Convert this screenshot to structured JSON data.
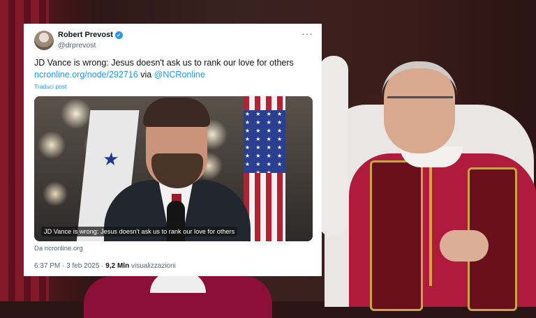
{
  "tweet": {
    "name": "Robert Prevost",
    "handle": "@drprevost",
    "text_line1": "JD Vance is wrong: Jesus doesn't ask us to rank our love for others",
    "link_url": "ncronline.org/node/292716",
    "via_word": "via",
    "mention": "@NCRonline",
    "translate": "Traduci post",
    "media_caption": "JD Vance is wrong: Jesus doesn't ask us to rank our love for others",
    "source": "Da ncronline.org",
    "time_date": "6:37 PM · 3 feb 2025 · ",
    "views_count": "9,2 Mln",
    "views_label": "visualizzazioni",
    "more_icon": "more-horizontal-icon",
    "verified_icon": "verified-badge-icon"
  },
  "colors": {
    "link": "#1d9bf0",
    "text": "#0f1419",
    "muted": "#536471",
    "verified": "#1d9bf0"
  }
}
